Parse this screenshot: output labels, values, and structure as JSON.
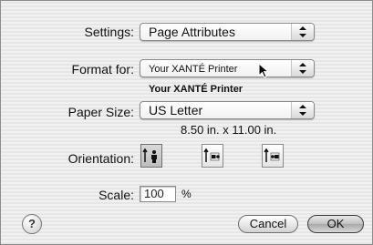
{
  "settings": {
    "label": "Settings:",
    "value": "Page Attributes"
  },
  "format_for": {
    "label": "Format for:",
    "value": "Your XANTÉ Printer",
    "caption": "Your XANTÉ Printer"
  },
  "paper_size": {
    "label": "Paper Size:",
    "value": "US Letter",
    "dimensions": "8.50 in. x 11.00 in."
  },
  "orientation": {
    "label": "Orientation:",
    "options": [
      "portrait",
      "landscape-left",
      "landscape-right"
    ],
    "selected": "portrait"
  },
  "scale": {
    "label": "Scale:",
    "value": "100",
    "unit": "%"
  },
  "buttons": {
    "help": "?",
    "cancel": "Cancel",
    "ok": "OK"
  }
}
